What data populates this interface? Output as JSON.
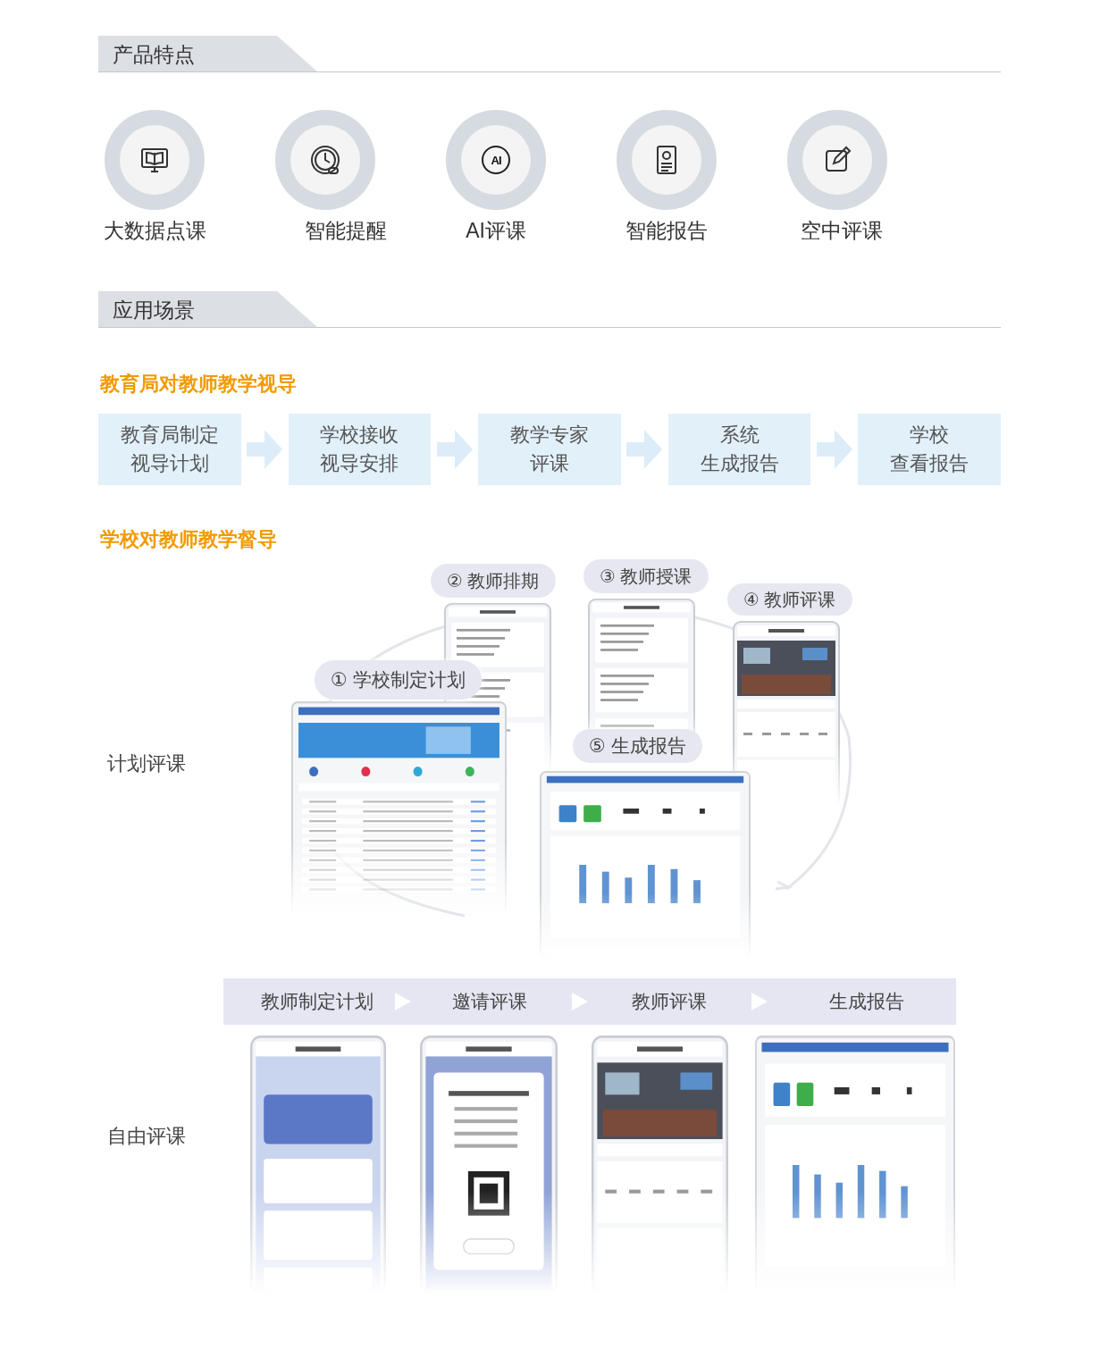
{
  "features_section": {
    "title": "产品特点",
    "features": [
      {
        "label": "大数据点课"
      },
      {
        "label": "智能提醒"
      },
      {
        "label": "AI评课",
        "icon_text": "AI"
      },
      {
        "label": "智能报告"
      },
      {
        "label": "空中评课"
      }
    ]
  },
  "scenarios_section": {
    "title": "应用场景",
    "bureau": {
      "heading": "教育局对教师教学视导",
      "steps": [
        {
          "lines": [
            "教育局制定",
            "视导计划"
          ]
        },
        {
          "lines": [
            "学校接收",
            "视导安排"
          ]
        },
        {
          "lines": [
            "教学专家",
            "评课"
          ]
        },
        {
          "lines": [
            "系统",
            "生成报告"
          ]
        },
        {
          "lines": [
            "学校",
            "查看报告"
          ]
        }
      ]
    },
    "school": {
      "heading": "学校对教师教学督导",
      "planned": {
        "label": "计划评课",
        "steps": [
          "② 教师排期",
          "③ 教师授课",
          "④ 教师评课",
          "① 学校制定计划",
          "⑤ 生成报告"
        ]
      },
      "free": {
        "label": "自由评课",
        "steps": [
          "教师制定计划",
          "邀请评课",
          "教师评课",
          "生成报告"
        ]
      }
    }
  }
}
